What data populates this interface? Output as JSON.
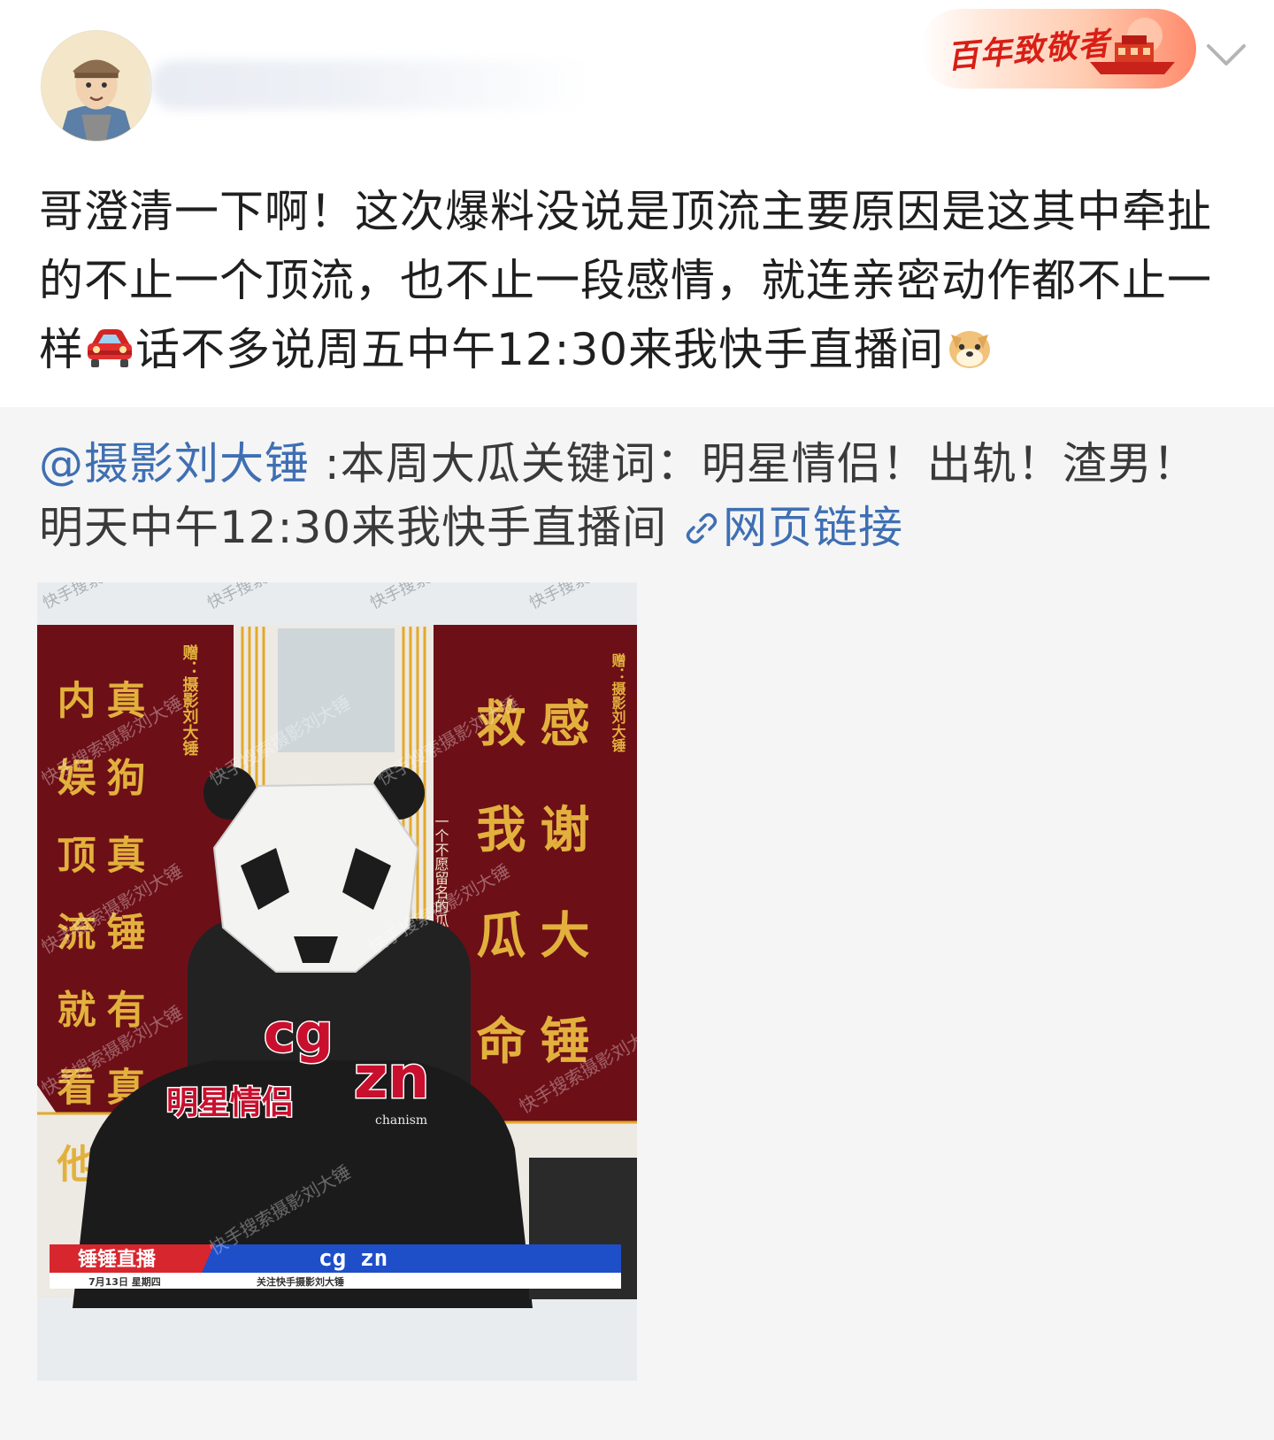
{
  "header": {
    "badge_text": "百年致敬者",
    "avatar_icon": "cartoon-man-avatar-icon",
    "more_icon": "chevron-down-icon"
  },
  "post": {
    "text_before_car": "哥澄清一下啊！这次爆料没说是顶流主要原因是这其中牵扯的不止一个顶流，也不止一段感情，就连亲密动作都不止一样",
    "car_icon": "car-emoji-icon",
    "text_after_car": "话不多说周五中午12:30来我快手直播间",
    "doge_icon": "doge-emoji-icon"
  },
  "repost": {
    "mention": "@摄影刘大锤",
    "text": " :本周大瓜关键词：明星情侣！出轨！渣男！明天中午12:30来我快手直播间",
    "link_icon": "link-icon",
    "link_text": "网页链接"
  },
  "video": {
    "banner_left_text": "真 狗 真 锤 有 真 瓜",
    "banner_left_text2": "内 娱 顶 流 就 看 他",
    "banner_left_note": "赠：摄影刘大锤",
    "banner_right_text": "感 谢 大 锤",
    "banner_right_text2": "救 我 瓜 命",
    "banner_right_note": "赠：摄影刘大锤",
    "middle_note": "一个不愿留名的瓜",
    "overlay_cg": "cg",
    "overlay_zn": "zn",
    "overlay_couple": "明星情侣",
    "shirt_text": "chanism",
    "lower_left_title": "锤锤直播",
    "lower_center_title": "cg zn",
    "lower_date": "7月13日 星期四",
    "lower_follow": "关注快手摄影刘大锤",
    "watermark": "快手搜索摄影刘大锤",
    "corner_watermark": "快手搜索"
  },
  "colors": {
    "link": "#3f6fb3",
    "repost_bg": "#f5f5f5",
    "banner_red": "#6e0f16",
    "gold": "#e1a62b"
  }
}
